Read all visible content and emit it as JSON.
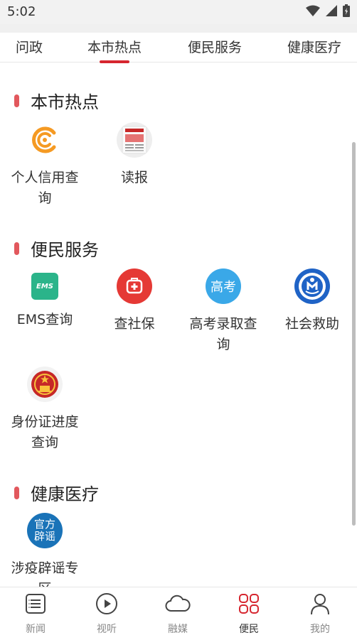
{
  "status": {
    "time": "5:02"
  },
  "tabs": [
    {
      "label": "问政"
    },
    {
      "label": "本市热点"
    },
    {
      "label": "便民服务"
    },
    {
      "label": "健康医疗"
    }
  ],
  "sections": {
    "hot": {
      "title": "本市热点",
      "items": [
        {
          "label": "个人信用查询",
          "icon": "credit-icon"
        },
        {
          "label": "读报",
          "icon": "newspaper-icon"
        }
      ]
    },
    "service": {
      "title": "便民服务",
      "items": [
        {
          "label": "EMS查询",
          "icon": "ems-icon",
          "icon_text": "EMS"
        },
        {
          "label": "查社保",
          "icon": "social-security-icon"
        },
        {
          "label": "高考录取查询",
          "icon": "gaokao-icon",
          "icon_text": "高考"
        },
        {
          "label": "社会救助",
          "icon": "relief-icon"
        },
        {
          "label": "身份证进度查询",
          "icon": "national-emblem-icon"
        }
      ]
    },
    "health": {
      "title": "健康医疗",
      "items": [
        {
          "label": "涉疫辟谣专区",
          "icon": "rumor-icon",
          "icon_text": "官方辟谣"
        }
      ]
    }
  },
  "bottom_nav": [
    {
      "label": "新闻",
      "icon": "news-icon"
    },
    {
      "label": "视听",
      "icon": "play-icon"
    },
    {
      "label": "融媒",
      "icon": "cloud-icon"
    },
    {
      "label": "便民",
      "icon": "grid-icon"
    },
    {
      "label": "我的",
      "icon": "person-icon"
    }
  ],
  "colors": {
    "accent_red": "#d6262f",
    "section_bar": "#e2585d",
    "credit_orange": "#f59a23",
    "ems_green": "#2bb48a",
    "shebao_red": "#e53935",
    "gaokao_blue": "#3aa8e8",
    "relief_blue": "#1f63c6",
    "rumor_blue": "#1a73b8"
  }
}
